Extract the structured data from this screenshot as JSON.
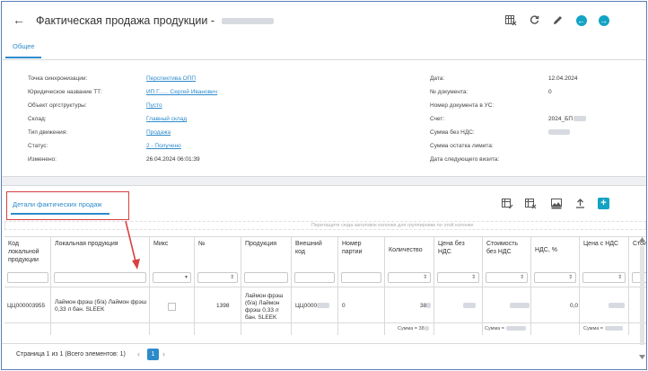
{
  "header": {
    "title": "Фактическая продажа продукции -"
  },
  "tabs": [
    {
      "label": "Общее"
    }
  ],
  "info_left": [
    {
      "label": "Точка синхронизации:",
      "value": "Перспектива ОПП",
      "link": true
    },
    {
      "label": "Юридическое название ТТ:",
      "value": "ИП Г...... Сергей Иванович",
      "link": true
    },
    {
      "label": "Объект оргструктуры:",
      "value": "Пусто",
      "link": true
    },
    {
      "label": "Склад:",
      "value": "Главный склад",
      "link": true
    },
    {
      "label": "Тип движения:",
      "value": "Продажа",
      "link": true
    },
    {
      "label": "Статус:",
      "value": "2 - Получено",
      "link": true
    },
    {
      "label": "Изменено:",
      "value": "26.04.2024 06:01:39",
      "link": false
    }
  ],
  "info_right": [
    {
      "label": "Дата:",
      "value": "12.04.2024"
    },
    {
      "label": "№ документа:",
      "value": "0"
    },
    {
      "label": "Номер документа в УС:",
      "value": ""
    },
    {
      "label": "Счет:",
      "value": "2024_БП"
    },
    {
      "label": "Сумма без НДС:",
      "value": ""
    },
    {
      "label": "Сумма остатка лимита:",
      "value": ""
    },
    {
      "label": "Дата следующего визита:",
      "value": ""
    }
  ],
  "details": {
    "tab_label": "Детали фактических продаж",
    "group_hint": "Перетащите сюда заголовок колонки для группировки по этой колонке"
  },
  "columns": [
    {
      "label": "Код локальной продукции"
    },
    {
      "label": "Локальная продукция"
    },
    {
      "label": "Микс"
    },
    {
      "label": "№"
    },
    {
      "label": "Продукция"
    },
    {
      "label": "Внешний код"
    },
    {
      "label": "Номер партии"
    },
    {
      "label": "Количество"
    },
    {
      "label": "Цена без НДС"
    },
    {
      "label": "Стоимость без НДС"
    },
    {
      "label": "НДС, %"
    },
    {
      "label": "Цена с НДС"
    },
    {
      "label": "Стои с НДС"
    }
  ],
  "row": {
    "code": "ЦЦ000003955",
    "local_product": "Лаймон фрэш (б/а) Лаймон фрэш 0,33 л бан. SLEEK",
    "number": "1398",
    "product": "Лаймон фрэш (б/а) Лаймон фрэш 0,33 л бан. SLEEK",
    "ext_code": "ЦЦ0000",
    "batch": "0",
    "qty": "38",
    "vat": "0,0"
  },
  "sums": {
    "qty": "Сумма = 38",
    "cost": "Сумма =",
    "price_vat": "Сумма ="
  },
  "pager": {
    "text": "Страница 1 из 1 (Всего элементов: 1)",
    "current": "1",
    "prev": "‹",
    "next": "›"
  },
  "colors": {
    "accent": "#2e8bcb",
    "action": "#13a3c4",
    "annotation": "#d94040"
  }
}
